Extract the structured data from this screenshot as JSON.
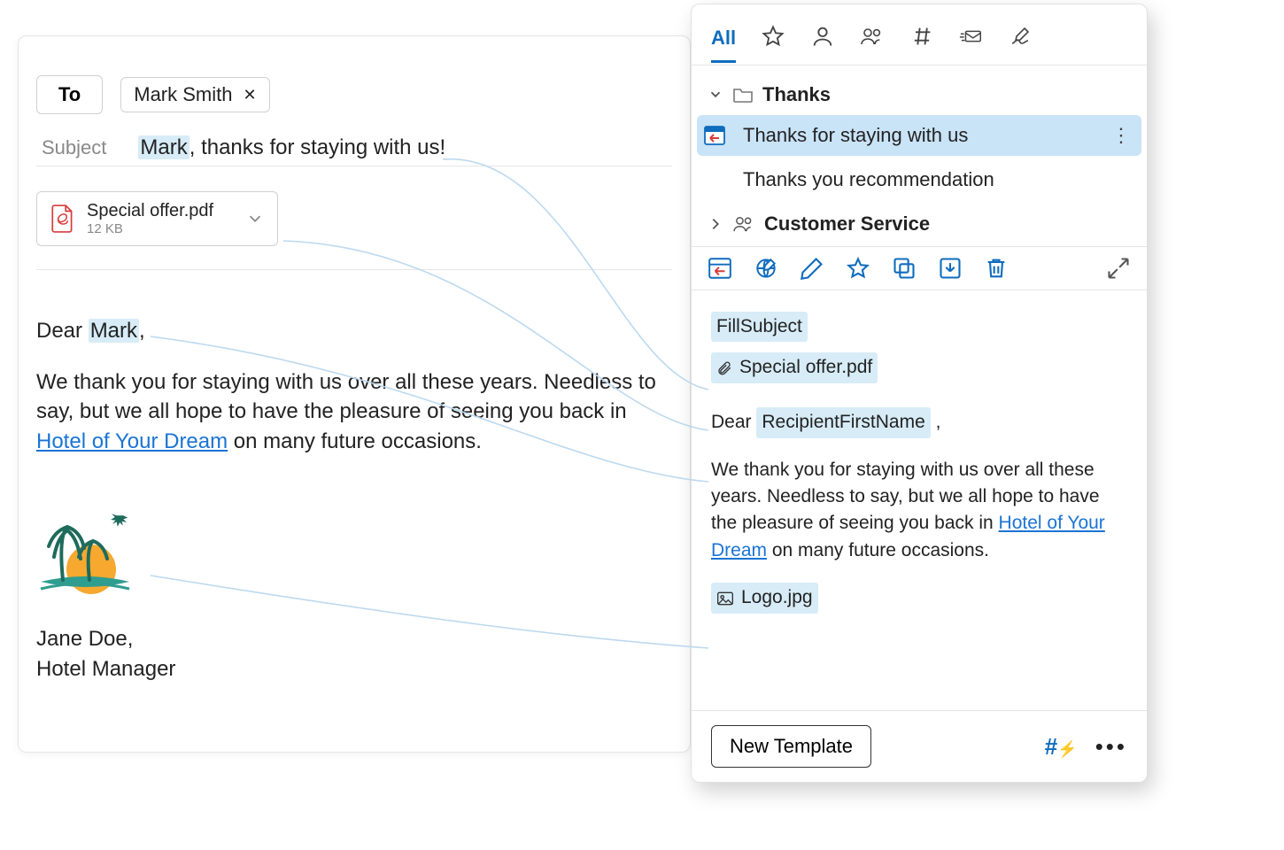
{
  "compose": {
    "to_button": "To",
    "recipient": "Mark Smith",
    "subject_label": "Subject",
    "subject_highlight": "Mark",
    "subject_rest": ", thanks for staying with us!",
    "attachment": {
      "name": "Special offer.pdf",
      "size": "12 KB"
    },
    "greeting_prefix": "Dear ",
    "greeting_name": "Mark",
    "greeting_suffix": ",",
    "para1a": "We thank you for staying with us over all these years. Needless to say, but we all hope to have the pleasure of seeing you back in ",
    "link_text": "Hotel of Your Dream",
    "para1b": " on many future occasions.",
    "sig1": "Jane Doe,",
    "sig2": "Hotel Manager"
  },
  "panel": {
    "tabs": {
      "all": "All"
    },
    "folders": [
      {
        "name": "Thanks",
        "expanded": true,
        "items": [
          {
            "label": "Thanks for staying with us",
            "selected": true
          },
          {
            "label": "Thanks you recommendation",
            "selected": false
          }
        ]
      },
      {
        "name": "Customer Service",
        "expanded": false,
        "shared": true
      }
    ],
    "template": {
      "macro_subject": "FillSubject",
      "attachment": "Special offer.pdf",
      "greeting_prefix": "Dear  ",
      "macro_name": "RecipientFirstName",
      "greeting_suffix": " ,",
      "para_a": "We thank you for staying with us over all these years. Needless to say, but we all hope to have the pleasure of seeing you back in ",
      "link": "Hotel of Your Dream",
      "para_b": " on many future occasions.",
      "image": "Logo.jpg"
    },
    "new_template_btn": "New Template"
  }
}
